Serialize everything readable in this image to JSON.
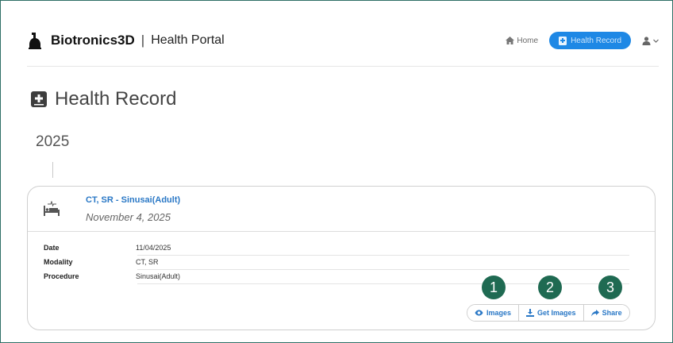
{
  "header": {
    "brand_name": "Biotronics3D",
    "separator": "|",
    "portal_name": "Health Portal",
    "nav": {
      "home_label": "Home",
      "active_label": "Health Record"
    }
  },
  "page": {
    "title": "Health Record",
    "year": "2025"
  },
  "record": {
    "title": "CT, SR - Sinusai(Adult)",
    "date": "November 4, 2025",
    "details": [
      {
        "label": "Date",
        "value": "11/04/2025"
      },
      {
        "label": "Modality",
        "value": "CT, SR"
      },
      {
        "label": "Procedure",
        "value": "Sinusai(Adult)"
      }
    ],
    "actions": {
      "images": "Images",
      "get_images": "Get Images",
      "share": "Share"
    }
  },
  "callouts": [
    "1",
    "2",
    "3"
  ],
  "colors": {
    "accent": "#1e88e5",
    "link": "#2a78c6",
    "callout": "#1f6a52",
    "frame": "#2f6f66"
  },
  "icons": {
    "brand": "brand-logo-icon",
    "home": "home-icon",
    "record": "medical-record-icon",
    "user": "user-icon",
    "bed": "hospital-bed-icon",
    "eye": "eye-icon",
    "download": "download-icon",
    "share": "share-arrow-icon"
  }
}
